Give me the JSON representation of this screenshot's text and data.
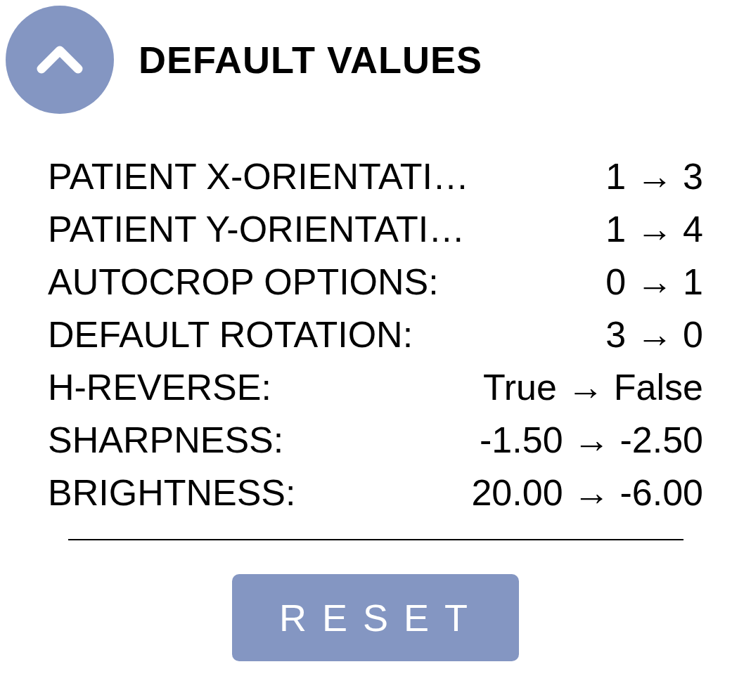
{
  "header": {
    "title": "DEFAULT VALUES",
    "expanded": true
  },
  "rows": [
    {
      "label": "PATIENT X-ORIENTATI…",
      "value": "1 → 3"
    },
    {
      "label": "PATIENT Y-ORIENTATI…",
      "value": "1 → 4"
    },
    {
      "label": "AUTOCROP OPTIONS:",
      "value": "0 → 1"
    },
    {
      "label": "DEFAULT ROTATION:",
      "value": "3 → 0"
    },
    {
      "label": "H-REVERSE:",
      "value": "True → False"
    },
    {
      "label": "SHARPNESS:",
      "value": "-1.50 → -2.50"
    },
    {
      "label": "BRIGHTNESS:",
      "value": "20.00 → -6.00"
    }
  ],
  "button": "RESET"
}
